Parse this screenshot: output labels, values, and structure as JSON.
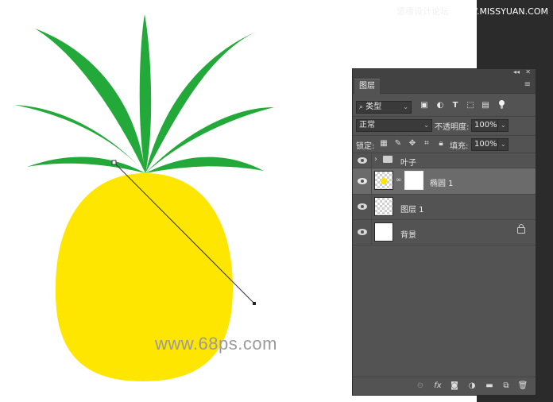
{
  "site": {
    "title_prefix": "思缘设计论坛",
    "title_domain": "WWW.MISSYUAN.COM"
  },
  "watermark": "www.68ps.com",
  "colors": {
    "leaf_green": "#22a93a",
    "pineapple_yellow": "#ffe600",
    "panel_bg": "#535353",
    "selected_layer": "#6b6b6b"
  },
  "panel": {
    "tab_label": "图层",
    "filter": {
      "kind_label": "类型",
      "icons": [
        "image-filter-icon",
        "adjustment-filter-icon",
        "type-filter-icon",
        "shape-filter-icon",
        "smart-object-filter-icon"
      ]
    },
    "blend": {
      "mode": "正常",
      "opacity_label": "不透明度:",
      "opacity_value": "100%"
    },
    "lock": {
      "lock_label": "锁定:",
      "fill_label": "填充:",
      "fill_value": "100%"
    },
    "layers": [
      {
        "name": "叶子",
        "type": "group"
      },
      {
        "name": "椭圆 1",
        "type": "masked",
        "selected": true
      },
      {
        "name": "图层 1",
        "type": "transparent"
      },
      {
        "name": "背景",
        "type": "background",
        "locked": true
      }
    ],
    "bottom_icons": [
      "link-layers-icon",
      "fx-icon",
      "add-mask-icon",
      "adjustment-layer-icon",
      "new-group-icon",
      "new-layer-icon",
      "delete-layer-icon"
    ]
  }
}
